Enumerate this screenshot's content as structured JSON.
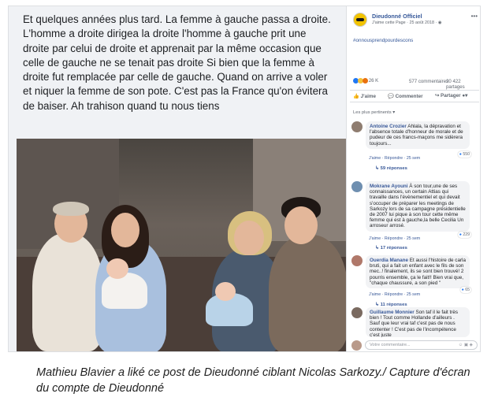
{
  "post": {
    "text": "Et quelques années plus tard. La femme à gauche passa a droite. L'homme a droite dirigea la droite l'homme à gauche prit une droite par celui de droite et apprenait par la même occasion que celle de gauche ne se tenait pas droite Si bien que la femme à droite fut remplacée par celle de gauche. Quand on arrive a voler et niquer la femme de son pote. C'est pas la France qu'on évitera de baiser. Ah trahison quand tu nous tiens"
  },
  "page": {
    "name": "Dieudonné Officiel",
    "meta": "J'aime cette Page · 25 août 2018 · ",
    "more": "•••",
    "hashtag": "#onnousprendpourdescons"
  },
  "stats": {
    "reactions": "26 K",
    "comments": "577 commentaires",
    "shares": "20 422 partages"
  },
  "actions": {
    "like": "J'aime",
    "comment": "Commenter",
    "share": "Partager"
  },
  "relevant": "Les plus pertinents ▾",
  "comments": [
    {
      "name": "Antoine Crozier",
      "text": "Ahlala, la dépravation et l'absence totale d'honneur de morale et de pudeur de ces francs-maçons me sidèrera toujours...",
      "actions": "J'aime · Répondre · 25 sem",
      "reactions": "550",
      "replies": "↳ 59 réponses"
    },
    {
      "name": "Mokrane Ayouni",
      "text": "À son tour,une de ses connaissances, un certain Attias qui travaille dans l'évènementiel et qui devait s'occuper de préparer les meetings de Sarkozy lors de sa campagne présidentielle de 2007 lui pique à son tour cette même femme qui est à gauche,la belle Cecilia Un arroseur arrosé.",
      "actions": "J'aime · Répondre · 25 sem",
      "reactions": "229",
      "replies": "↳ 17 réponses"
    },
    {
      "name": "Ouerdia Manane",
      "text": "Et aussi l'histoire de carla bruti, qui a fait un enfant avec le fils de son mec..! finalement, ils se sont bien trouvé! 2 pourris ensemble, ça le fait!! Bien vrai que, \"chaque chaussure, a son pied \"",
      "actions": "J'aime · Répondre · 25 sem",
      "reactions": "65",
      "replies": "↳ 11 réponses"
    },
    {
      "name": "Guillaume Monnier",
      "text": "Son taf il le fait très bien ! Tout comme Hollande d'ailleurs . Sauf que leur vrai taf c'est pas de nous contenter ! C'est pas de l'incompétence c'est juste",
      "actions": "",
      "reactions": "",
      "replies": ""
    }
  ],
  "comment_box": {
    "placeholder": "Votre commentaire..."
  },
  "caption": "Mathieu Blavier a liké ce post de Dieudonné ciblant Nicolas Sarkozy./ Capture d'écran du compte de Dieudonné",
  "colors": {
    "link": "#365899",
    "accent": "#f2c300",
    "like_blue": "#2078f4"
  }
}
